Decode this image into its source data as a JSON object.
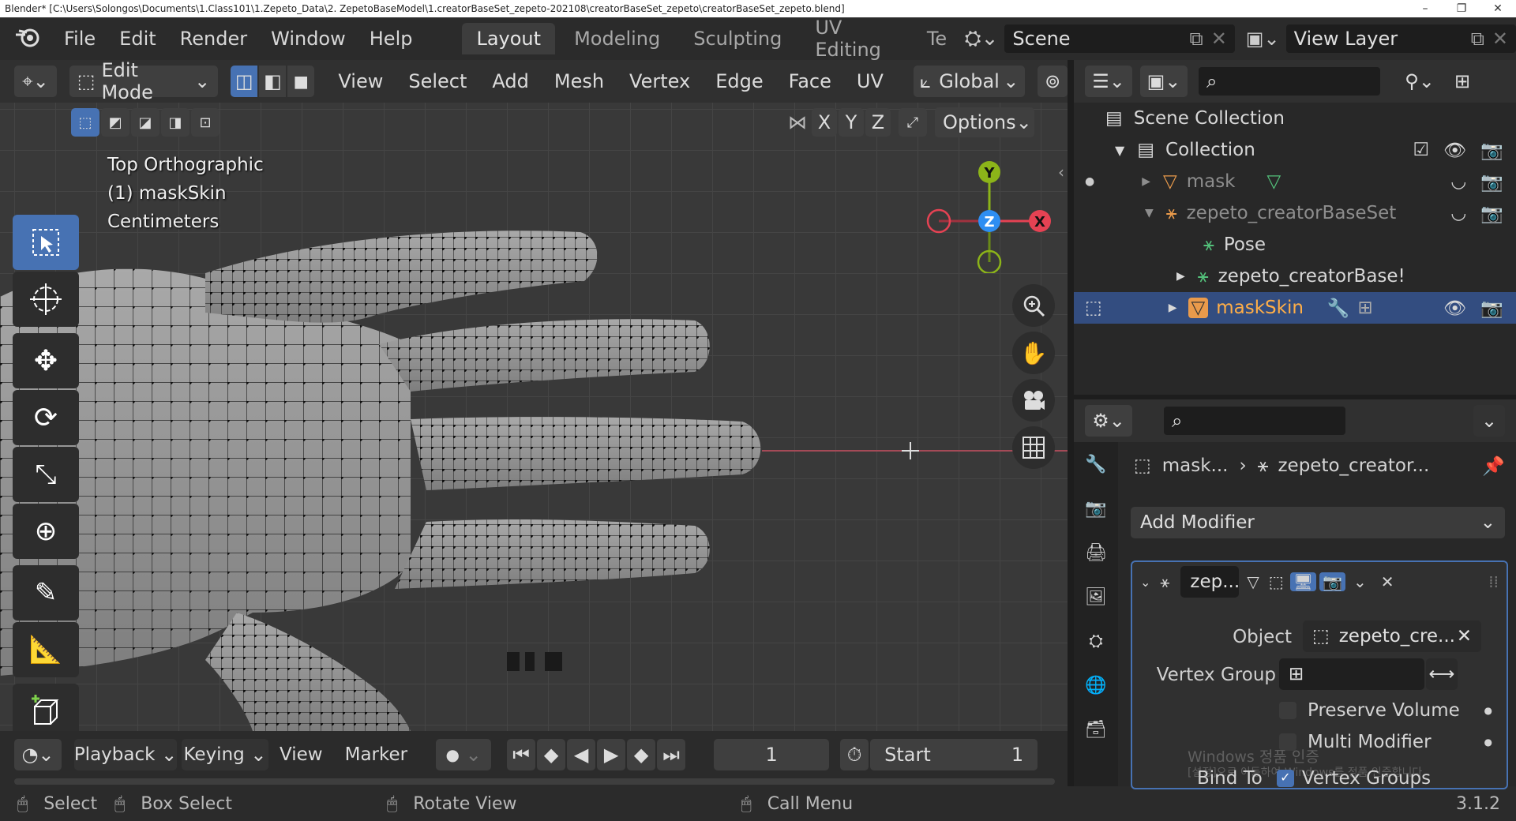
{
  "window": {
    "title": "Blender* [C:\\Users\\Solongos\\Documents\\1.Class101\\1.Zepeto_Data\\2. ZepetoBaseModel\\1.creatorBaseSet_zepeto-202108\\creatorBaseSet_zepeto\\creatorBaseSet_zepeto.blend]",
    "minimize": "–",
    "maximize": "❐",
    "close": "✕"
  },
  "menubar": {
    "items": [
      "File",
      "Edit",
      "Render",
      "Window",
      "Help"
    ],
    "workspaces": [
      "Layout",
      "Modeling",
      "Sculpting",
      "UV Editing",
      "Te"
    ],
    "active_workspace": "Layout",
    "scene": "Scene",
    "view_layer": "View Layer"
  },
  "viewport": {
    "mode": "Edit Mode",
    "menus": [
      "View",
      "Select",
      "Add",
      "Mesh",
      "Vertex",
      "Edge",
      "Face",
      "UV"
    ],
    "transform_orientation": "Global",
    "axis_toggles": [
      "X",
      "Y",
      "Z"
    ],
    "options_label": "Options",
    "overlay_lines": [
      "Top Orthographic",
      "(1) maskSkin",
      "Centimeters"
    ],
    "gizmo": {
      "y": "Y",
      "z": "Z",
      "x": "X"
    },
    "colors": {
      "x": "#e54253",
      "y": "#8cb419",
      "z": "#2e8ef2",
      "selected": "#4772b3"
    }
  },
  "timeline": {
    "menus": [
      "Playback",
      "Keying",
      "View",
      "Marker"
    ],
    "current_frame": "1",
    "start_label": "Start",
    "start_value": "1"
  },
  "statusbar": {
    "select": "Select",
    "box_select": "Box Select",
    "rotate_view": "Rotate View",
    "call_menu": "Call Menu",
    "version": "3.1.2"
  },
  "outliner": {
    "scene_collection": "Scene Collection",
    "collection": "Collection",
    "items": [
      "mask",
      "zepeto_creatorBaseSet",
      "Pose",
      "zepeto_creatorBase!",
      "maskSkin"
    ]
  },
  "properties": {
    "breadcrumb_object": "mask...",
    "breadcrumb_data": "zepeto_creator...",
    "add_modifier": "Add Modifier",
    "modifier_name": "zep...",
    "object_label": "Object",
    "object_value": "zepeto_cre...",
    "vertex_group_label": "Vertex Group",
    "preserve_volume": "Preserve Volume",
    "multi_modifier": "Multi Modifier",
    "bind_to_label": "Bind To",
    "vertex_groups": "Vertex Groups",
    "watermark": "Windows 정품 인증",
    "watermark_sub": "[설정]으로 이동하여 Windows를 정품 인증합니다."
  }
}
